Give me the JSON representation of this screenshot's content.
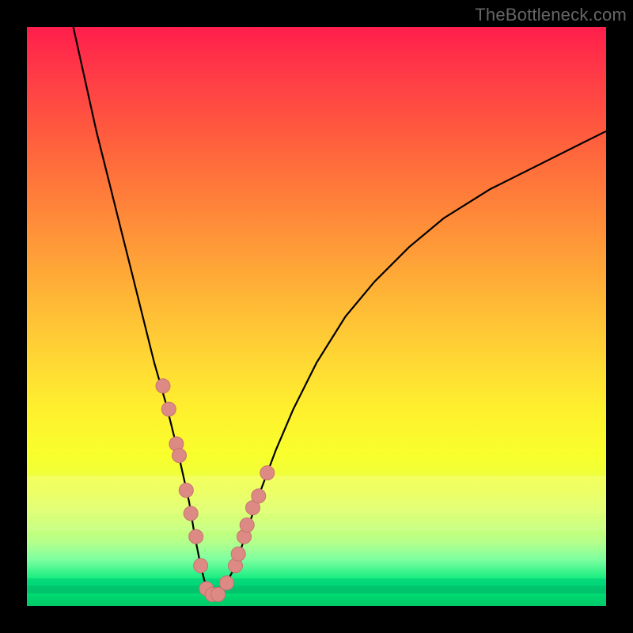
{
  "watermark": "TheBottleneck.com",
  "colors": {
    "curve": "#000000",
    "marker_fill": "#dd8a85",
    "marker_stroke": "#c47470",
    "background_black": "#000000"
  },
  "chart_data": {
    "type": "line",
    "title": "",
    "xlabel": "",
    "ylabel": "",
    "xlim": [
      0,
      100
    ],
    "ylim": [
      0,
      100
    ],
    "series": [
      {
        "name": "curve",
        "x": [
          8,
          10,
          12,
          14,
          16,
          18,
          20,
          22,
          24,
          26,
          28,
          29,
          30,
          31,
          32,
          33,
          34,
          36,
          38,
          40,
          43,
          46,
          50,
          55,
          60,
          66,
          72,
          80,
          88,
          96,
          100
        ],
        "y": [
          100,
          91,
          82,
          74,
          66,
          58,
          50,
          42,
          35,
          27,
          18,
          12,
          7,
          3,
          2,
          2,
          3,
          7,
          13,
          19,
          27,
          34,
          42,
          50,
          56,
          62,
          67,
          72,
          76,
          80,
          82
        ]
      }
    ],
    "markers": {
      "name": "highlighted-points",
      "x": [
        23.5,
        24.5,
        25.8,
        26.3,
        27.5,
        28.3,
        29.2,
        30.0,
        31.0,
        32.0,
        33.0,
        34.5,
        36.0,
        36.5,
        37.5,
        38.0,
        39.0,
        40.0,
        41.5
      ],
      "y": [
        38,
        34,
        28,
        26,
        20,
        16,
        12,
        7,
        3,
        2,
        2,
        4,
        7,
        9,
        12,
        14,
        17,
        19,
        23
      ]
    },
    "gradient_stops": [
      {
        "pos": 0,
        "color": "#ff1e4b"
      },
      {
        "pos": 18,
        "color": "#ff5a3e"
      },
      {
        "pos": 38,
        "color": "#ff9a38"
      },
      {
        "pos": 58,
        "color": "#ffd934"
      },
      {
        "pos": 74,
        "color": "#f8ff2c"
      },
      {
        "pos": 89,
        "color": "#b4ff8c"
      },
      {
        "pos": 100,
        "color": "#00c968"
      }
    ]
  }
}
